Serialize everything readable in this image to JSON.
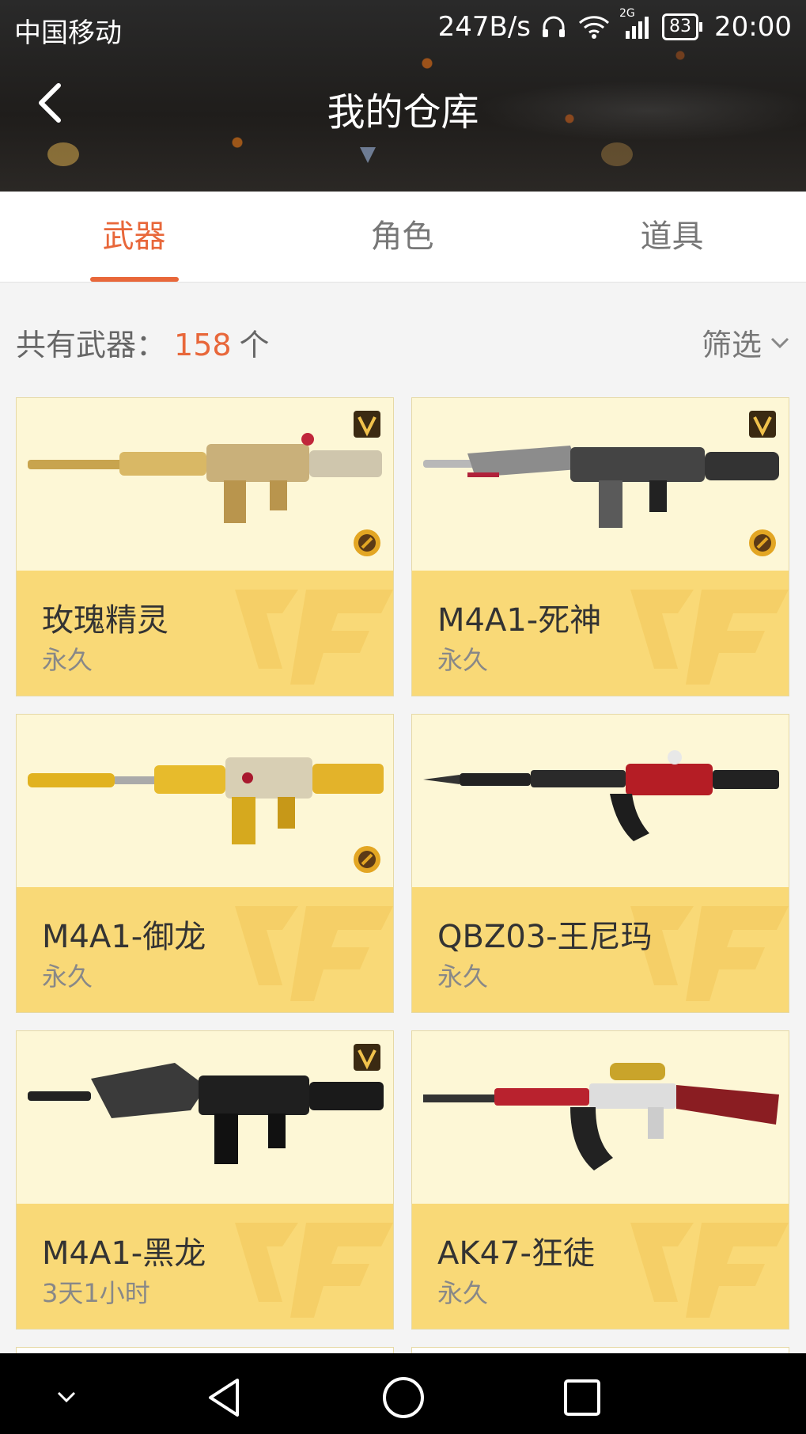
{
  "status_bar": {
    "carrier": "中国移动",
    "speed": "247B/s",
    "network": "2G",
    "battery": "83",
    "time": "20:00"
  },
  "header": {
    "title": "我的仓库"
  },
  "tabs": [
    {
      "label": "武器",
      "active": true
    },
    {
      "label": "角色",
      "active": false
    },
    {
      "label": "道具",
      "active": false
    }
  ],
  "summary": {
    "prefix": "共有武器：",
    "count": "158",
    "suffix": "个",
    "filter_label": "筛选"
  },
  "weapons": [
    {
      "name": "玫瑰精灵",
      "duration": "永久",
      "vip": true,
      "coin": true
    },
    {
      "name": "M4A1-死神",
      "duration": "永久",
      "vip": true,
      "coin": true
    },
    {
      "name": "M4A1-御龙",
      "duration": "永久",
      "vip": false,
      "coin": true
    },
    {
      "name": "QBZ03-王尼玛",
      "duration": "永久",
      "vip": false,
      "coin": false
    },
    {
      "name": "M4A1-黑龙",
      "duration": "3天1小时",
      "vip": true,
      "coin": false
    },
    {
      "name": "AK47-狂徒",
      "duration": "永久",
      "vip": false,
      "coin": false
    }
  ],
  "colors": {
    "accent": "#e8673a",
    "card_info_bg": "#f9d977",
    "card_img_bg": "#fdf7d6"
  }
}
